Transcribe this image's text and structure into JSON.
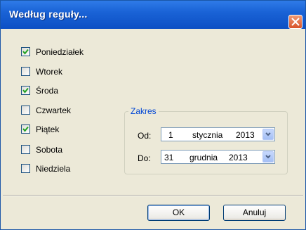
{
  "window": {
    "title": "Według reguły..."
  },
  "days": [
    {
      "label": "Poniedziałek",
      "checked": true
    },
    {
      "label": "Wtorek",
      "checked": false
    },
    {
      "label": "Środa",
      "checked": true
    },
    {
      "label": "Czwartek",
      "checked": false
    },
    {
      "label": "Piątek",
      "checked": true
    },
    {
      "label": "Sobota",
      "checked": false
    },
    {
      "label": "Niedziela",
      "checked": false
    }
  ],
  "range": {
    "legend": "Zakres",
    "from": {
      "label": "Od:",
      "day": "1",
      "month": "stycznia",
      "year": "2013"
    },
    "to": {
      "label": "Do:",
      "day": "31",
      "month": "grudnia",
      "year": "2013"
    }
  },
  "buttons": {
    "ok": "OK",
    "cancel": "Anuluj"
  }
}
